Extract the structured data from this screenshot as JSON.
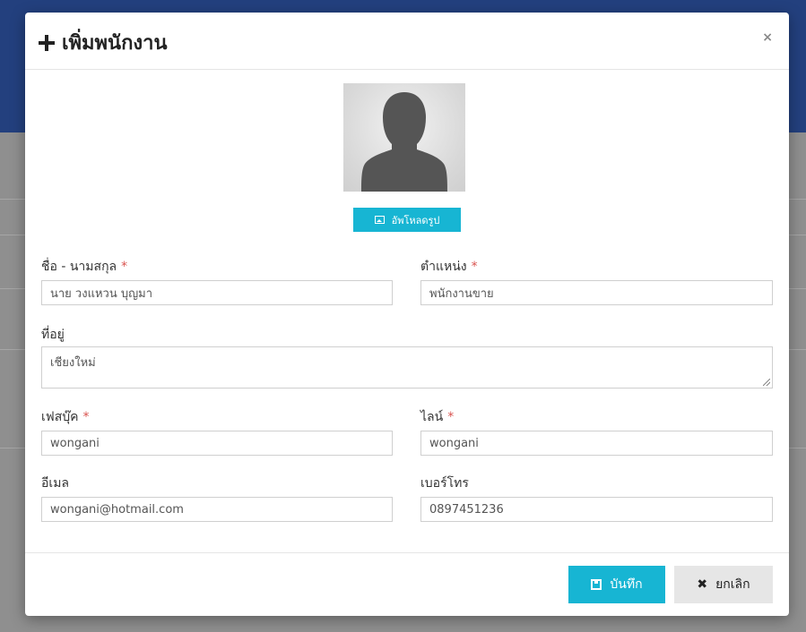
{
  "modal": {
    "title": "เพิ่มพนักงาน",
    "close_glyph": "×"
  },
  "upload": {
    "label": "อัพโหลดรูป"
  },
  "form": {
    "name": {
      "label": "ชื่อ - นามสกุล",
      "required": "*",
      "value": "นาย วงแหวน บุญมา"
    },
    "position": {
      "label": "ตำแหน่ง",
      "required": "*",
      "value": "พนักงานขาย"
    },
    "address": {
      "label": "ที่อยู่",
      "value": "เชียงใหม่"
    },
    "facebook": {
      "label": "เฟสบุ๊ค",
      "required": "*",
      "value": "wongani"
    },
    "line": {
      "label": "ไลน์",
      "required": "*",
      "value": "wongani"
    },
    "email": {
      "label": "อีเมล",
      "value": "wongani@hotmail.com"
    },
    "phone": {
      "label": "เบอร์โทร",
      "value": "0897451236"
    }
  },
  "footer": {
    "save_label": "บันทึก",
    "cancel_label": "ยกเลิก",
    "cancel_glyph": "✖"
  },
  "colors": {
    "accent": "#17b5d3",
    "header_bg": "#23407e",
    "required": "#d9534f"
  }
}
